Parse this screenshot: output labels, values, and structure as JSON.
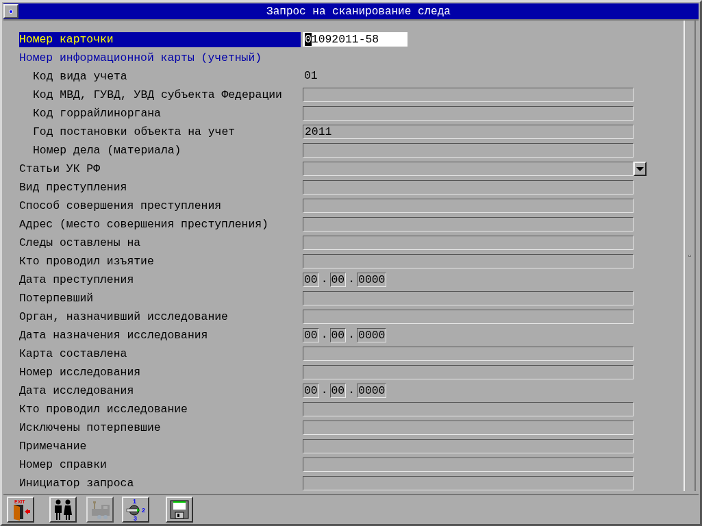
{
  "window": {
    "title": "Запрос на сканирование следа"
  },
  "fields": [
    {
      "label": "Номер карточки",
      "kind": "text",
      "value": "01092011-58",
      "selected": true
    },
    {
      "label": "Номер информационной карты (учетный)",
      "kind": "heading",
      "selected": false,
      "children": [
        {
          "label": "Код вида учета",
          "kind": "static",
          "value": "01",
          "selected": false
        },
        {
          "label": "Код МВД, ГУВД, УВД субъекта Федерации",
          "kind": "text",
          "selected": false
        },
        {
          "label": "Код горрайлиноргана",
          "kind": "text",
          "selected": false
        },
        {
          "label": "Год постановки объекта на учет",
          "kind": "text",
          "value": "2011",
          "selected": false
        },
        {
          "label": "Номер дела (материала)",
          "kind": "text",
          "selected": false
        }
      ]
    },
    {
      "label": "Статьи УК РФ",
      "kind": "select",
      "selected": false
    },
    {
      "label": "Вид преступления",
      "kind": "text",
      "selected": false
    },
    {
      "label": "Способ совершения преступления",
      "kind": "text",
      "selected": false
    },
    {
      "label": "Адрес (место совершения преступления)",
      "kind": "text",
      "selected": false
    },
    {
      "label": "Следы оставлены на",
      "kind": "text",
      "selected": false
    },
    {
      "label": "Кто проводил изъятие",
      "kind": "text",
      "selected": false
    },
    {
      "label": "Дата преступления",
      "kind": "date",
      "parts": [
        "00",
        "00",
        "0000"
      ],
      "separator": ".",
      "selected": false
    },
    {
      "label": "Потерпевший",
      "kind": "text",
      "selected": false
    },
    {
      "label": "Орган, назначивший исследование",
      "kind": "text",
      "selected": false
    },
    {
      "label": "Дата назначения исследования",
      "kind": "date",
      "parts": [
        "00",
        "00",
        "0000"
      ],
      "separator": ".",
      "selected": false
    },
    {
      "label": "Карта составлена",
      "kind": "text",
      "selected": false
    },
    {
      "label": "Номер исследования",
      "kind": "text",
      "selected": false
    },
    {
      "label": "Дата исследования",
      "kind": "date",
      "parts": [
        "00",
        "00",
        "0000"
      ],
      "separator": ".",
      "selected": false
    },
    {
      "label": "Кто проводил исследование",
      "kind": "text",
      "selected": false
    },
    {
      "label": "Исключены потерпевшие",
      "kind": "text",
      "selected": false
    },
    {
      "label": "Примечание",
      "kind": "text",
      "selected": false
    },
    {
      "label": "Номер справки",
      "kind": "text",
      "selected": false
    },
    {
      "label": "Инициатор запроса",
      "kind": "text",
      "selected": false
    }
  ],
  "toolbar": [
    {
      "kind": "exit",
      "sign": "EXIT",
      "disabled": false
    },
    {
      "kind": "people",
      "disabled": false
    },
    {
      "kind": "train",
      "disabled": true
    },
    {
      "kind": "dial",
      "marks": [
        "1",
        "2",
        "3"
      ],
      "disabled": false
    },
    {
      "kind": "save",
      "disabled": false
    }
  ]
}
